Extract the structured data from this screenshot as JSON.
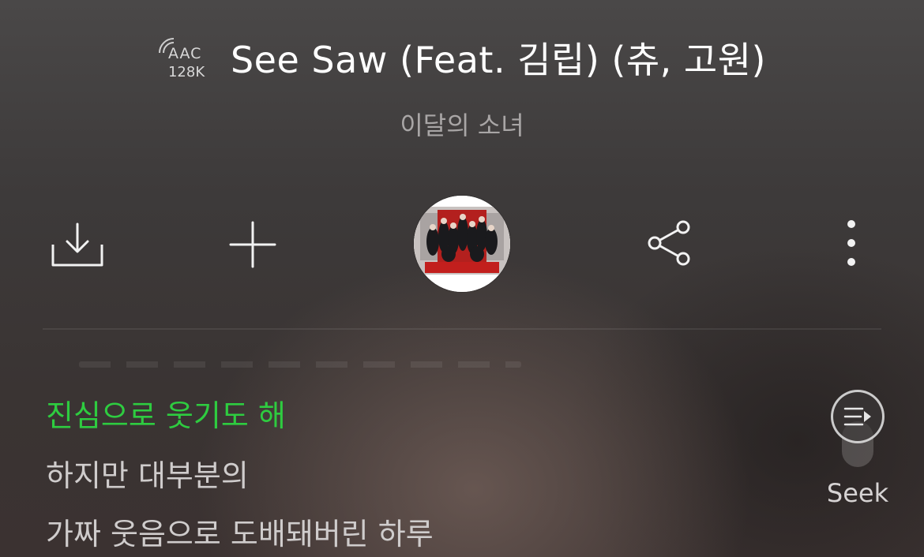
{
  "player": {
    "codec_format": "AAC",
    "codec_bitrate": "128K",
    "title": "See Saw (Feat. 김립) (츄, 고원)",
    "artist": "이달의 소녀"
  },
  "actions": {
    "download_icon": "download-icon",
    "add_icon": "plus-icon",
    "share_icon": "share-icon",
    "more_icon": "more-vertical-icon"
  },
  "lyrics": {
    "current": "진심으로 웃기도 해",
    "next": [
      "하지만 대부분의",
      "가짜 웃음으로 도배돼버린 하루"
    ]
  },
  "seek": {
    "label": "Seek",
    "icon": "lyrics-seek-icon"
  },
  "colors": {
    "highlight": "#2ecc40",
    "text_dim": "#a9a6a6"
  }
}
